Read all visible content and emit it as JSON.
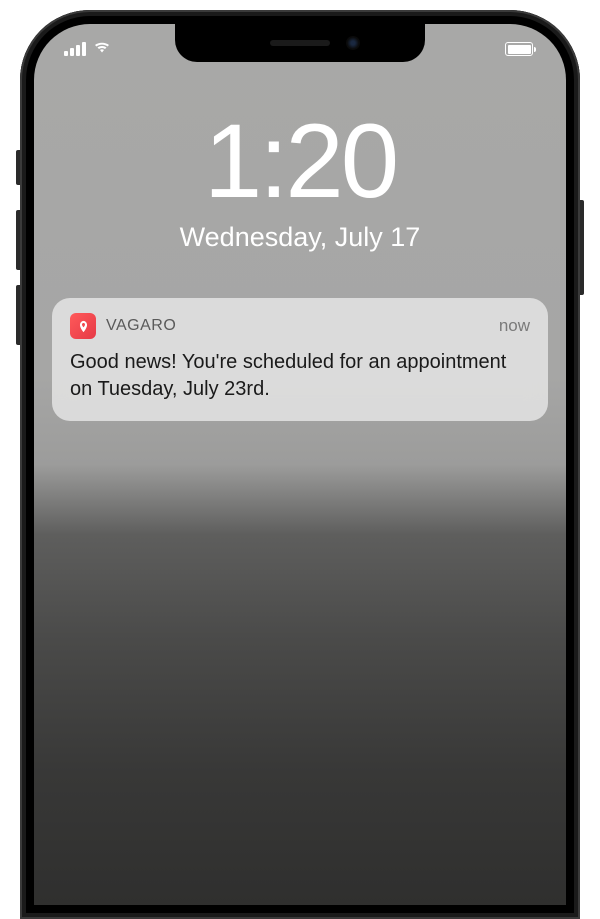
{
  "statusbar": {
    "signal_level": 4,
    "wifi": true,
    "battery_level": 100
  },
  "lockscreen": {
    "time": "1:20",
    "date": "Wednesday, July 17"
  },
  "notification": {
    "app_name": "VAGARO",
    "app_icon": "vagaro-logo-icon",
    "timestamp": "now",
    "message": "Good news! You're scheduled for an appointment on Tuesday, July 23rd."
  }
}
